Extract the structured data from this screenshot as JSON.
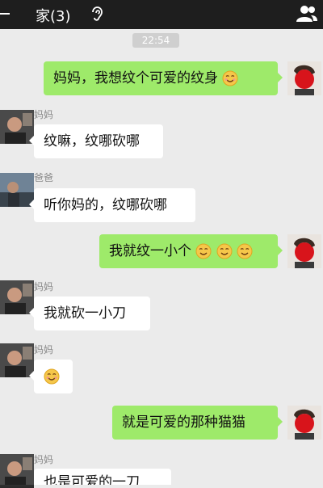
{
  "header": {
    "title": "家(3)",
    "back_icon": "back-arrow-icon",
    "mute_icon": "ear-icon",
    "members_icon": "group-icon"
  },
  "timestamp": "22:54",
  "messages": [
    {
      "sender": "me",
      "text": "妈妈，我想纹个可爱的纹身",
      "emoji_count": 1
    },
    {
      "sender": "妈妈",
      "text": "纹嘛，纹哪砍哪"
    },
    {
      "sender": "爸爸",
      "text": "听你妈的，纹哪砍哪"
    },
    {
      "sender": "me",
      "text": "我就纹一小个",
      "emoji_count": 3
    },
    {
      "sender": "妈妈",
      "text": "我就砍一小刀"
    },
    {
      "sender": "妈妈",
      "text": "",
      "emoji_count": 1
    },
    {
      "sender": "me",
      "text": "就是可爱的那种猫猫"
    },
    {
      "sender": "妈妈",
      "text": "也是可爱的一刀"
    }
  ],
  "colors": {
    "out_bubble": "#9eea6a",
    "in_bubble": "#ffffff",
    "background": "#ebebeb",
    "topbar": "#1e1e1e"
  }
}
